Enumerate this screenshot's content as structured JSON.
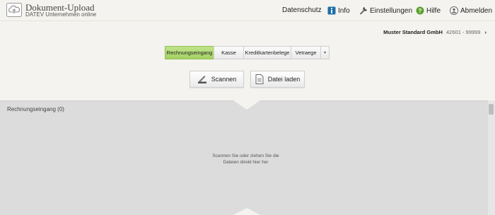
{
  "header": {
    "title": "Dokument-Upload",
    "subtitle": "DATEV Unternehmen online",
    "logo_icon": "cloud-upload-icon",
    "nav": {
      "privacy": "Datenschutz",
      "info": "Info",
      "settings": "Einstellungen",
      "help": "Hilfe",
      "logout": "Abmelden"
    }
  },
  "company": {
    "name": "Muster Standard GmbH",
    "number": "42601 - 99999",
    "chevron": "›"
  },
  "tabs": [
    {
      "label": "Rechnungseingang",
      "active": true
    },
    {
      "label": "Kasse",
      "active": false
    },
    {
      "label": "Kreditkartenbelege",
      "active": false
    },
    {
      "label": "Vetraege",
      "active": false
    }
  ],
  "tabs_more": "▾",
  "actions": {
    "scan": "Scannen",
    "load": "Datei laden"
  },
  "dropzone": {
    "title": "Rechnungseingang (0)",
    "hint_line1": "Scannen Sie oder ziehen Sie die",
    "hint_line2": "Dateien direkt hier her"
  },
  "colors": {
    "accent_green": "#a4d163",
    "info_blue": "#1e6fa8",
    "help_green": "#5aa12f"
  }
}
